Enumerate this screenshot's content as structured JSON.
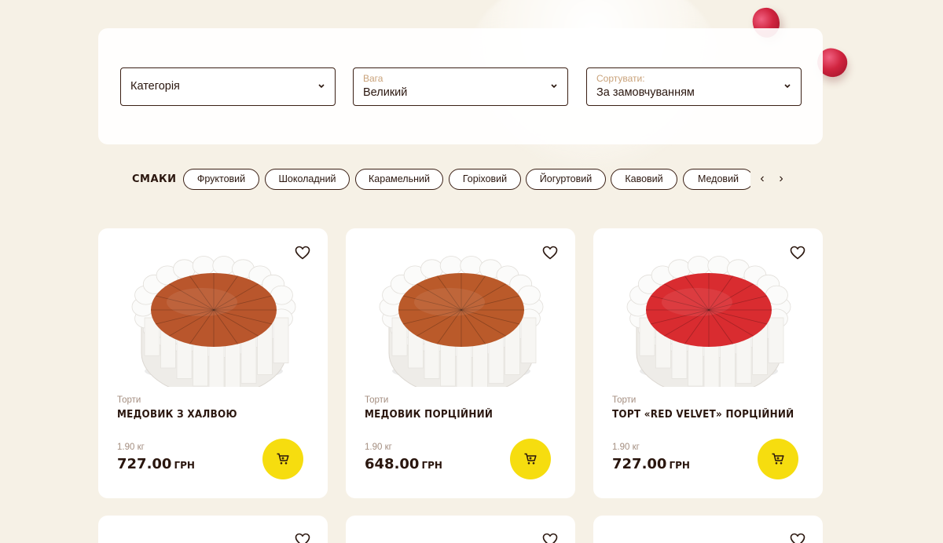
{
  "filters": {
    "category": {
      "value": "Категорія"
    },
    "weight": {
      "label": "Вага",
      "value": "Великий"
    },
    "sort": {
      "label": "Сортувати:",
      "value": "За замовчуванням"
    }
  },
  "flavors": {
    "title": "СМАКИ",
    "items": [
      "Фруктовий",
      "Шоколадний",
      "Карамельний",
      "Горіховий",
      "Йогуртовий",
      "Кавовий",
      "Медовий"
    ],
    "prev_icon": "chevron-left-icon",
    "next_icon": "chevron-right-icon"
  },
  "products": [
    {
      "category": "Торти",
      "name": "МЕДОВИК З ХАЛВОЮ",
      "weight": "1.90 кг",
      "price": "727.00",
      "currency": "ГРН",
      "top_color": "#b9562c"
    },
    {
      "category": "Торти",
      "name": "МЕДОВИК ПОРЦІЙНИЙ",
      "weight": "1.90 кг",
      "price": "648.00",
      "currency": "ГРН",
      "top_color": "#ba5a2a"
    },
    {
      "category": "Торти",
      "name": "ТОРТ «RED VELVET» ПОРЦІЙНИЙ",
      "weight": "1.90 кг",
      "price": "727.00",
      "currency": "ГРН",
      "top_color": "#d92c30"
    }
  ],
  "colors": {
    "accent_yellow": "#f6dd0f",
    "text_dark": "#2a160e",
    "page_bg": "#f6f1e6"
  }
}
